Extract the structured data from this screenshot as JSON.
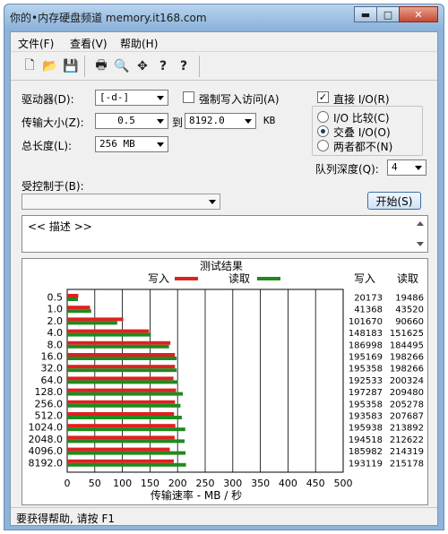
{
  "window": {
    "title": "你的•内存硬盘频道 memory.it168.com",
    "minimize": "▬",
    "maximize": "□",
    "close": "✕"
  },
  "menu": [
    {
      "label": "文件(F)"
    },
    {
      "label": "查看(V)"
    },
    {
      "label": "帮助(H)"
    }
  ],
  "toolbar": {
    "icons": [
      "new-file-icon",
      "open-folder-icon",
      "save-disk-icon",
      "print-icon",
      "print-preview-icon",
      "move-cross-icon",
      "help-question-icon",
      "context-help-icon"
    ],
    "glyphs": [
      "🗋",
      "📂",
      "💾",
      "🖶",
      "🔍",
      "✥",
      "?",
      "?"
    ]
  },
  "settings": {
    "drive_label": "驱动器(D):",
    "drive_value": "[-d-]",
    "force_write_label": "强制写入访问(A)",
    "transfer_label": "传输大小(Z):",
    "transfer_from": "0.5",
    "transfer_to_label": "到",
    "transfer_to": "8192.0",
    "transfer_unit": "KB",
    "length_label": "总长度(L):",
    "length_value": "256 MB",
    "direct_io_label": "直接 I/O(R)",
    "direct_io_checked": true,
    "io_compare_label": "I/O 比较(C)",
    "overlapped_io_label": "交叠 I/O(O)",
    "neither_label": "两者都不(N)",
    "selected_mode": "overlapped",
    "queue_depth_label": "队列深度(Q):",
    "queue_depth_value": "4",
    "controlled_by_label": "受控制于(B):",
    "controlled_by_value": "",
    "start_button": "开始(S)",
    "description": "<< 描述 >>"
  },
  "chart_data": {
    "type": "bar",
    "title": "测试结果",
    "xlabel": "传输速率 - MB / 秒",
    "ylabel": "",
    "xlim": [
      0,
      500
    ],
    "xticks": [
      0,
      50,
      100,
      150,
      200,
      250,
      300,
      350,
      400,
      450,
      500
    ],
    "categories": [
      "0.5",
      "1.0",
      "2.0",
      "4.0",
      "8.0",
      "16.0",
      "32.0",
      "64.0",
      "128.0",
      "256.0",
      "512.0",
      "1024.0",
      "2048.0",
      "4096.0",
      "8192.0"
    ],
    "col_write": "写入",
    "col_read": "读取",
    "series": [
      {
        "name": "写入",
        "color": "#e02020",
        "values": [
          20173,
          41368,
          101670,
          148183,
          186998,
          195169,
          195358,
          192533,
          197287,
          195358,
          193583,
          195938,
          194518,
          185982,
          193119
        ]
      },
      {
        "name": "读取",
        "color": "#1f8a1f",
        "values": [
          19486,
          43520,
          90660,
          151625,
          184495,
          198266,
          198266,
          200324,
          209480,
          205278,
          207687,
          213892,
          212622,
          214319,
          215178
        ]
      }
    ],
    "legend": "top-center",
    "grid": true
  },
  "status": {
    "text": "要获得帮助, 请按 F1"
  }
}
